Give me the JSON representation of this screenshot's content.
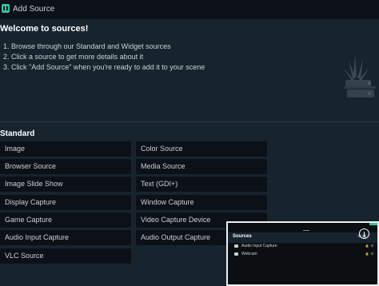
{
  "window": {
    "title": "Add Source"
  },
  "intro": {
    "heading": "Welcome to sources!",
    "steps": [
      "1. Browse through our Standard and Widget sources",
      "2. Click a source to get more details about it",
      "3. Click \"Add Source\" when you're ready to add it to your scene"
    ]
  },
  "standard": {
    "heading": "Standard",
    "left": [
      "Image",
      "Browser Source",
      "Image Slide Show",
      "Display Capture",
      "Game Capture",
      "Audio Input Capture",
      "VLC Source"
    ],
    "right": [
      "Color Source",
      "Media Source",
      "Text (GDI+)",
      "Window Capture",
      "Video Capture Device",
      "Audio Output Capture"
    ]
  },
  "sources_panel": {
    "title": "Sources",
    "items": [
      "Audio Input Capture",
      "Webcam"
    ]
  },
  "colors": {
    "accent": "#31c3a2",
    "background": "#17242d",
    "button": "#0b1116"
  }
}
